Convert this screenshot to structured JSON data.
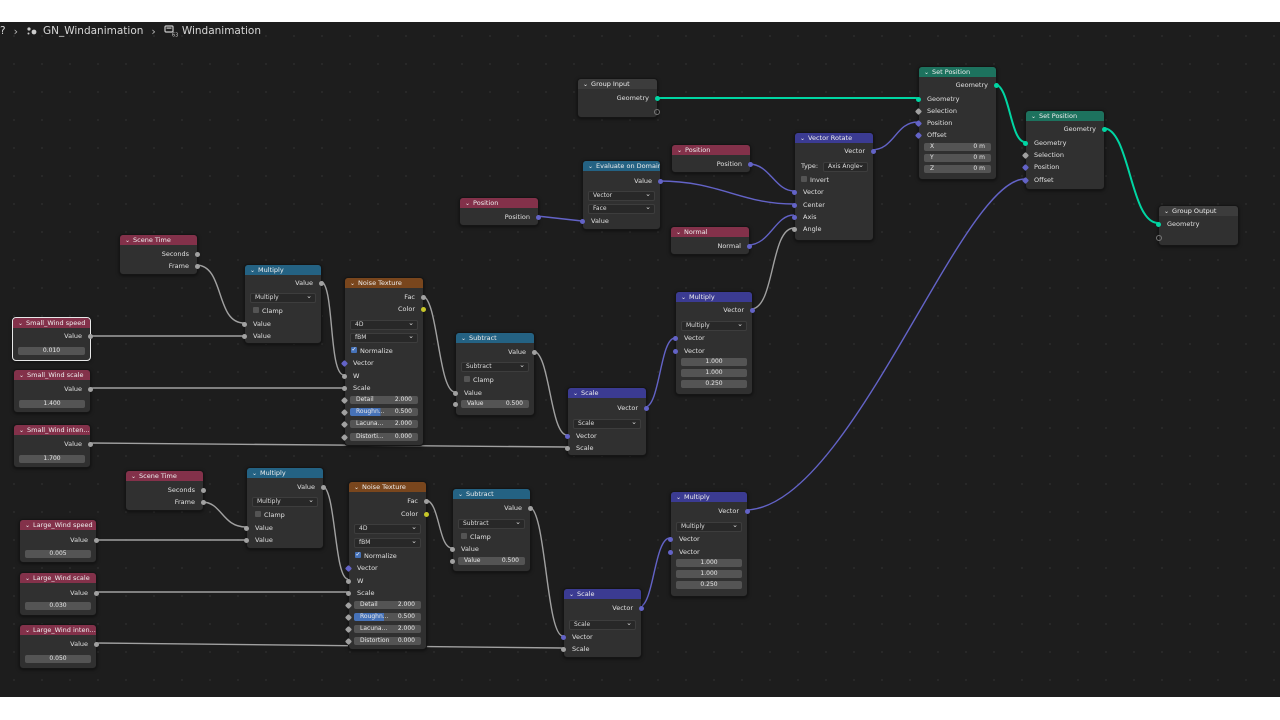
{
  "breadcrumb": {
    "root_glyph": "?",
    "object": "GN_Windanimation",
    "tree": "Windanimation"
  },
  "colors": {
    "input": "#83314a",
    "geometry": "#1d725e",
    "converter": "#246283",
    "texture": "#79461d",
    "vector": "#3b3b92",
    "group": "#3c3c3c",
    "geometry_wire": "#00d6a3",
    "vector_wire": "#6363c7"
  },
  "nodes": {
    "group_input": {
      "title": "Group Input",
      "out_geometry": "Geometry"
    },
    "set_position_1": {
      "title": "Set Position",
      "out_geometry": "Geometry",
      "in_geometry": "Geometry",
      "in_selection": "Selection",
      "in_position": "Position",
      "in_offset": "Offset",
      "x_label": "X",
      "x_value": "0 m",
      "y_label": "Y",
      "y_value": "0 m",
      "z_label": "Z",
      "z_value": "0 m"
    },
    "set_position_2": {
      "title": "Set Position",
      "out_geometry": "Geometry",
      "in_geometry": "Geometry",
      "in_selection": "Selection",
      "in_position": "Position",
      "in_offset": "Offset"
    },
    "group_output": {
      "title": "Group Output",
      "in_geometry": "Geometry"
    },
    "vector_rotate": {
      "title": "Vector Rotate",
      "out_vector": "Vector",
      "type_label": "Type:",
      "type_value": "Axis Angle",
      "invert": "Invert",
      "in_vector": "Vector",
      "in_center": "Center",
      "in_axis": "Axis",
      "in_angle": "Angle"
    },
    "position_top": {
      "title": "Position",
      "out": "Position"
    },
    "normal": {
      "title": "Normal",
      "out": "Normal"
    },
    "evaluate_domain": {
      "title": "Evaluate on Domain",
      "out_value": "Value",
      "type": "Vector",
      "domain": "Face",
      "in_value": "Value"
    },
    "position_mid": {
      "title": "Position",
      "out": "Position"
    },
    "scene_time_1": {
      "title": "Scene Time",
      "out_seconds": "Seconds",
      "out_frame": "Frame"
    },
    "multiply_1": {
      "title": "Multiply",
      "out_value": "Value",
      "op": "Multiply",
      "clamp": "Clamp",
      "in_a": "Value",
      "in_b": "Value"
    },
    "noise_1": {
      "title": "Noise Texture",
      "out_fac": "Fac",
      "out_color": "Color",
      "dim": "4D",
      "type": "fBM",
      "normalize": "Normalize",
      "in_vector": "Vector",
      "in_w": "W",
      "in_scale": "Scale",
      "detail_k": "Detail",
      "detail_v": "2.000",
      "rough_k": "Roughn...",
      "rough_v": "0.500",
      "lac_k": "Lacuna...",
      "lac_v": "2.000",
      "dist_k": "Distorti...",
      "dist_v": "0.000"
    },
    "subtract_1": {
      "title": "Subtract",
      "out_value": "Value",
      "op": "Subtract",
      "clamp": "Clamp",
      "in_value": "Value",
      "val_k": "Value",
      "val_v": "0.500"
    },
    "scale_1": {
      "title": "Scale",
      "out_vector": "Vector",
      "op": "Scale",
      "in_vector": "Vector",
      "in_scale": "Scale"
    },
    "vmul_1": {
      "title": "Multiply",
      "out_vector": "Vector",
      "op": "Multiply",
      "in_a": "Vector",
      "in_b": "Vector",
      "v1": "1.000",
      "v2": "1.000",
      "v3": "0.250"
    },
    "small_speed": {
      "title": "Small_Wind speed",
      "out": "Value",
      "value": "0.010"
    },
    "small_scale": {
      "title": "Small_Wind scale",
      "out": "Value",
      "value": "1.400"
    },
    "small_inten": {
      "title": "Small_Wind inten...",
      "out": "Value",
      "value": "1.700"
    },
    "scene_time_2": {
      "title": "Scene Time",
      "out_seconds": "Seconds",
      "out_frame": "Frame"
    },
    "multiply_2": {
      "title": "Multiply",
      "out_value": "Value",
      "op": "Multiply",
      "clamp": "Clamp",
      "in_a": "Value",
      "in_b": "Value"
    },
    "noise_2": {
      "title": "Noise Texture",
      "out_fac": "Fac",
      "out_color": "Color",
      "dim": "4D",
      "type": "fBM",
      "normalize": "Normalize",
      "in_vector": "Vector",
      "in_w": "W",
      "in_scale": "Scale",
      "detail_k": "Detail",
      "detail_v": "2.000",
      "rough_k": "Roughn...",
      "rough_v": "0.500",
      "lac_k": "Lacuna...",
      "lac_v": "2.000",
      "dist_k": "Distortion",
      "dist_v": "0.000"
    },
    "subtract_2": {
      "title": "Subtract",
      "out_value": "Value",
      "op": "Subtract",
      "clamp": "Clamp",
      "in_value": "Value",
      "val_k": "Value",
      "val_v": "0.500"
    },
    "scale_2": {
      "title": "Scale",
      "out_vector": "Vector",
      "op": "Scale",
      "in_vector": "Vector",
      "in_scale": "Scale"
    },
    "vmul_2": {
      "title": "Multiply",
      "out_vector": "Vector",
      "op": "Multiply",
      "in_a": "Vector",
      "in_b": "Vector",
      "v1": "1.000",
      "v2": "1.000",
      "v3": "0.250"
    },
    "large_speed": {
      "title": "Large_Wind speed",
      "out": "Value",
      "value": "0.005"
    },
    "large_scale": {
      "title": "Large_Wind scale",
      "out": "Value",
      "value": "0.030"
    },
    "large_inten": {
      "title": "Large_Wind inten...",
      "out": "Value",
      "value": "0.050"
    }
  }
}
